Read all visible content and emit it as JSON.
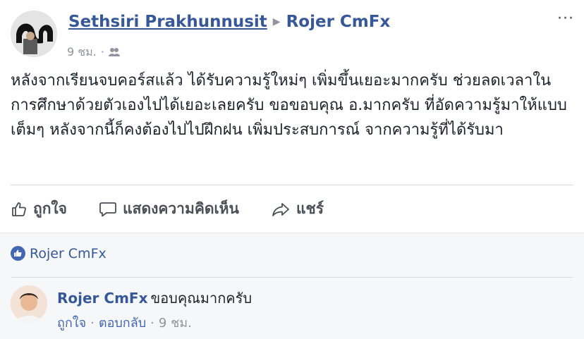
{
  "post": {
    "author": "Sethsiri Prakhunnusit",
    "target_page": "Rojer CmFx",
    "timestamp": "9 ชม.",
    "more_menu": "···",
    "text": "หลังจากเรียนจบคอร์สแล้ว ได้รับความรู้ใหม่ๆ เพิ่มขึ้นเยอะมากครับ ช่วยลดเวลาในการศึกษาด้วยตัวเองไปได้เยอะเลยครับ ขอขอบคุณ อ.มากครับ ที่อัดความรู้มาให้แบบเต็มๆ หลังจากนี้ก็คงต้องไปไปฝึกฝน เพิ่มประสบการณ์ จากความรู้ที่ได้รับมา",
    "actions": {
      "like": "ถูกใจ",
      "comment": "แสดงความคิดเห็น",
      "share": "แชร์"
    }
  },
  "reactions": {
    "liked_by": "Rojer CmFx"
  },
  "comment": {
    "author": "Rojer CmFx",
    "text": "ขอบคุณมากครับ",
    "like": "ถูกใจ",
    "reply": "ตอบกลับ",
    "timestamp": "9 ชม."
  },
  "colors": {
    "link": "#365899",
    "meta": "#90949c",
    "accent": "#4267b2"
  }
}
